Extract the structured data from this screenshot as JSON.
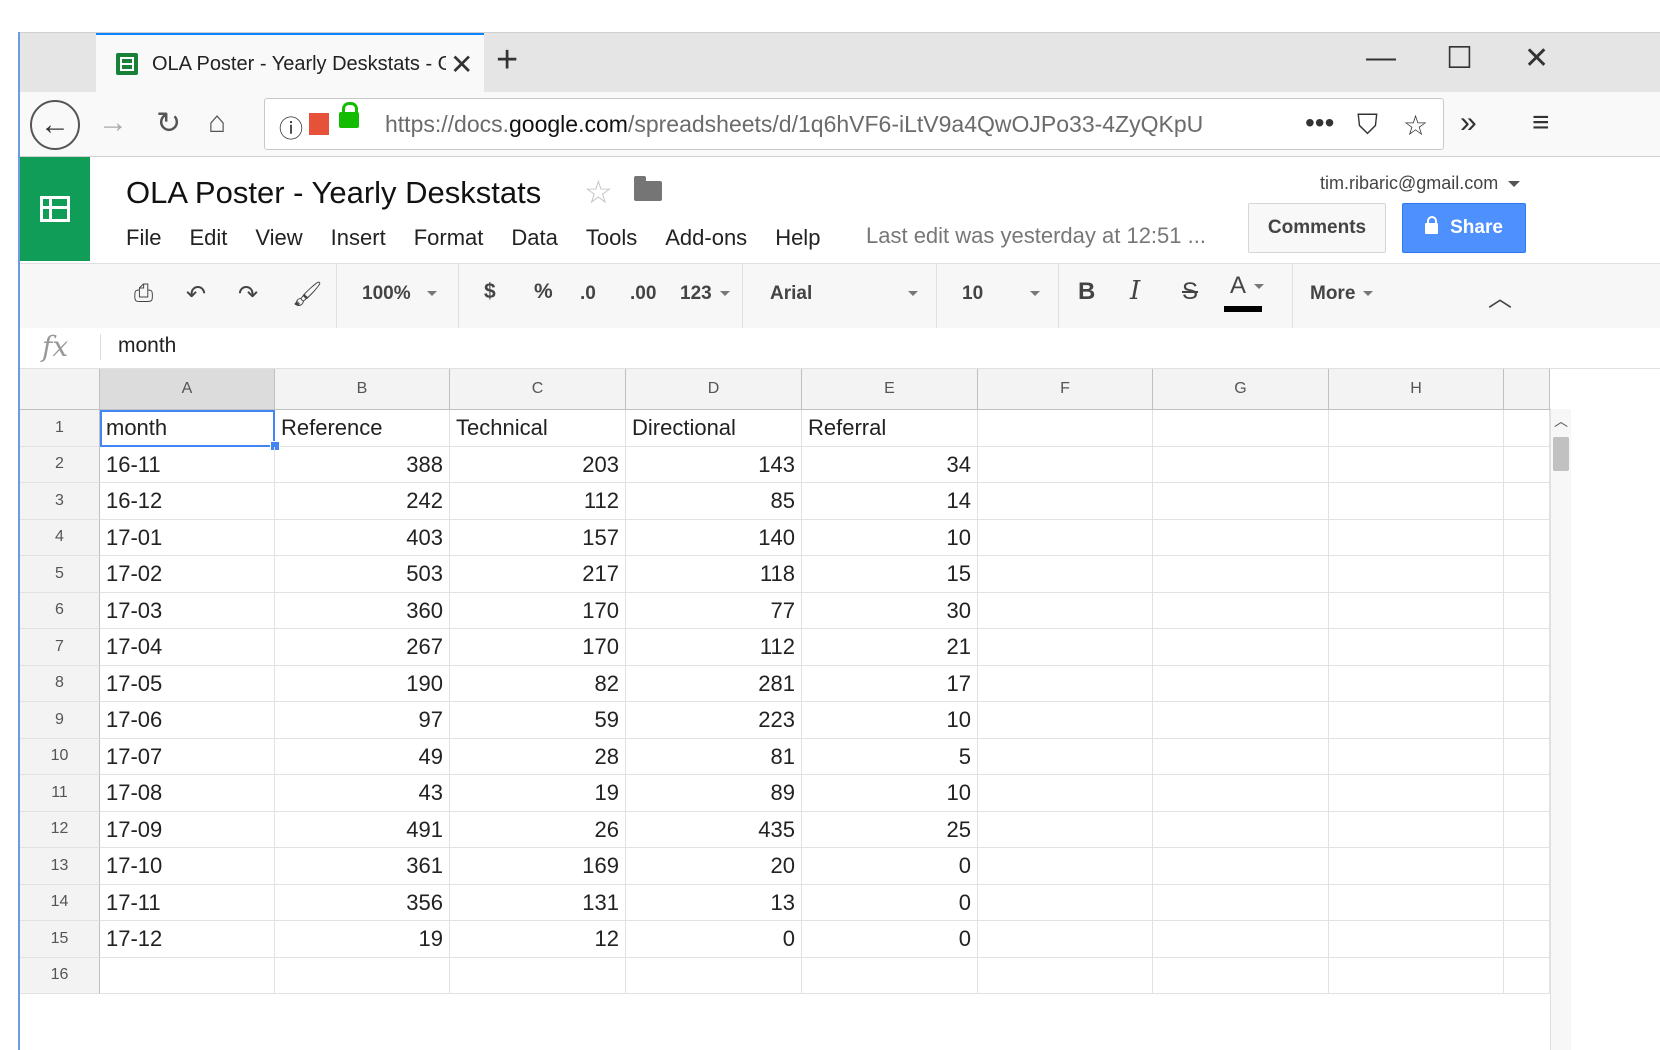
{
  "browser": {
    "tab_title": "OLA Poster - Yearly Deskstats - G",
    "tab_close": "✕",
    "new_tab": "+",
    "url_prefix": "https://docs.",
    "url_domain": "google.com",
    "url_path": "/spreadsheets/d/1q6hVF6-iLtV9a4QwOJPo33-4ZyQKpU",
    "icons": [
      "back-arrow-icon",
      "forward-arrow-icon",
      "reload-icon",
      "home-icon",
      "info-icon",
      "lock-icon",
      "more-icon",
      "pocket-icon",
      "bookmark-star-icon",
      "overflow-icon",
      "hamburger-menu-icon"
    ]
  },
  "app": {
    "doc_title": "OLA Poster - Yearly Deskstats",
    "menu": [
      "File",
      "Edit",
      "View",
      "Insert",
      "Format",
      "Data",
      "Tools",
      "Add-ons",
      "Help"
    ],
    "last_edit": "Last edit was yesterday at 12:51 ...",
    "user_email": "tim.ribaric@gmail.com",
    "comments_label": "Comments",
    "share_label": "Share",
    "accent_color": "#0f9d58",
    "share_color": "#4d90fe"
  },
  "toolbar": {
    "zoom": "100%",
    "currency": "$",
    "percent": "%",
    "decrease_decimal": ".0",
    "increase_decimal": ".00",
    "number_format": "123",
    "font": "Arial",
    "font_size": "10",
    "bold": "B",
    "italic": "I",
    "strike": "S",
    "text_color": "A",
    "more": "More"
  },
  "formula_bar": {
    "fx": "fx",
    "value": "month"
  },
  "sheet": {
    "columns": [
      "A",
      "B",
      "C",
      "D",
      "E",
      "F",
      "G",
      "H"
    ],
    "row_numbers": [
      "1",
      "2",
      "3",
      "4",
      "5",
      "6",
      "7",
      "8",
      "9",
      "10",
      "11",
      "12",
      "13",
      "14",
      "15",
      "16"
    ],
    "header": [
      "month",
      "Reference",
      "Technical",
      "Directional",
      "Referral"
    ],
    "rows": [
      [
        "16-11",
        "388",
        "203",
        "143",
        "34"
      ],
      [
        "16-12",
        "242",
        "112",
        "85",
        "14"
      ],
      [
        "17-01",
        "403",
        "157",
        "140",
        "10"
      ],
      [
        "17-02",
        "503",
        "217",
        "118",
        "15"
      ],
      [
        "17-03",
        "360",
        "170",
        "77",
        "30"
      ],
      [
        "17-04",
        "267",
        "170",
        "112",
        "21"
      ],
      [
        "17-05",
        "190",
        "82",
        "281",
        "17"
      ],
      [
        "17-06",
        "97",
        "59",
        "223",
        "10"
      ],
      [
        "17-07",
        "49",
        "28",
        "81",
        "5"
      ],
      [
        "17-08",
        "43",
        "19",
        "89",
        "10"
      ],
      [
        "17-09",
        "491",
        "26",
        "435",
        "25"
      ],
      [
        "17-10",
        "361",
        "169",
        "20",
        "0"
      ],
      [
        "17-11",
        "356",
        "131",
        "13",
        "0"
      ],
      [
        "17-12",
        "19",
        "12",
        "0",
        "0"
      ]
    ]
  }
}
